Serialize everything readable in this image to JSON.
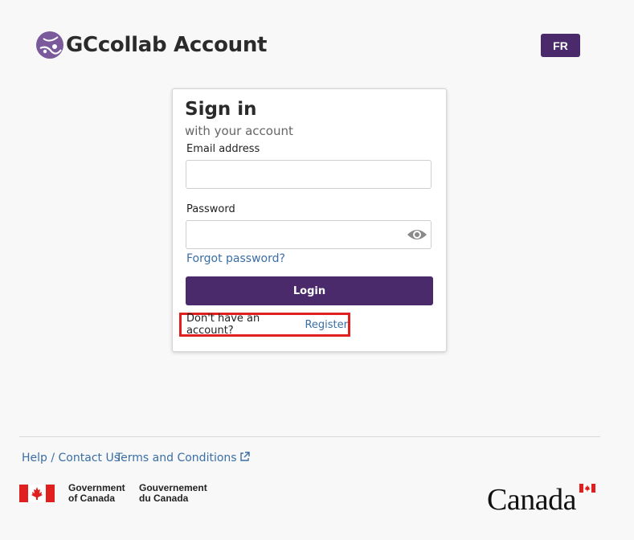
{
  "header": {
    "app_title": "GCcollab Account",
    "lang_button": "FR",
    "logo_icon": "gccollab-globe-icon"
  },
  "signin": {
    "title": "Sign in",
    "subtitle": "with your account",
    "email_label": "Email address",
    "email_value": "",
    "password_label": "Password",
    "password_value": "",
    "forgot_link": "Forgot password?",
    "login_button": "Login",
    "no_account_text": "Don't have an account?",
    "register_link": "Register"
  },
  "footer": {
    "help_link": "Help / Contact Us",
    "terms_link": "Terms and Conditions",
    "gov_en_line1": "Government",
    "gov_en_line2": "of Canada",
    "gov_fr_line1": "Gouvernement",
    "gov_fr_line2": "du Canada",
    "wordmark": "Canada"
  },
  "colors": {
    "brand_purple": "#4a2a6a",
    "link_blue": "#3a6ea5",
    "highlight_red": "#e0201f",
    "flag_red": "#e0201f"
  }
}
